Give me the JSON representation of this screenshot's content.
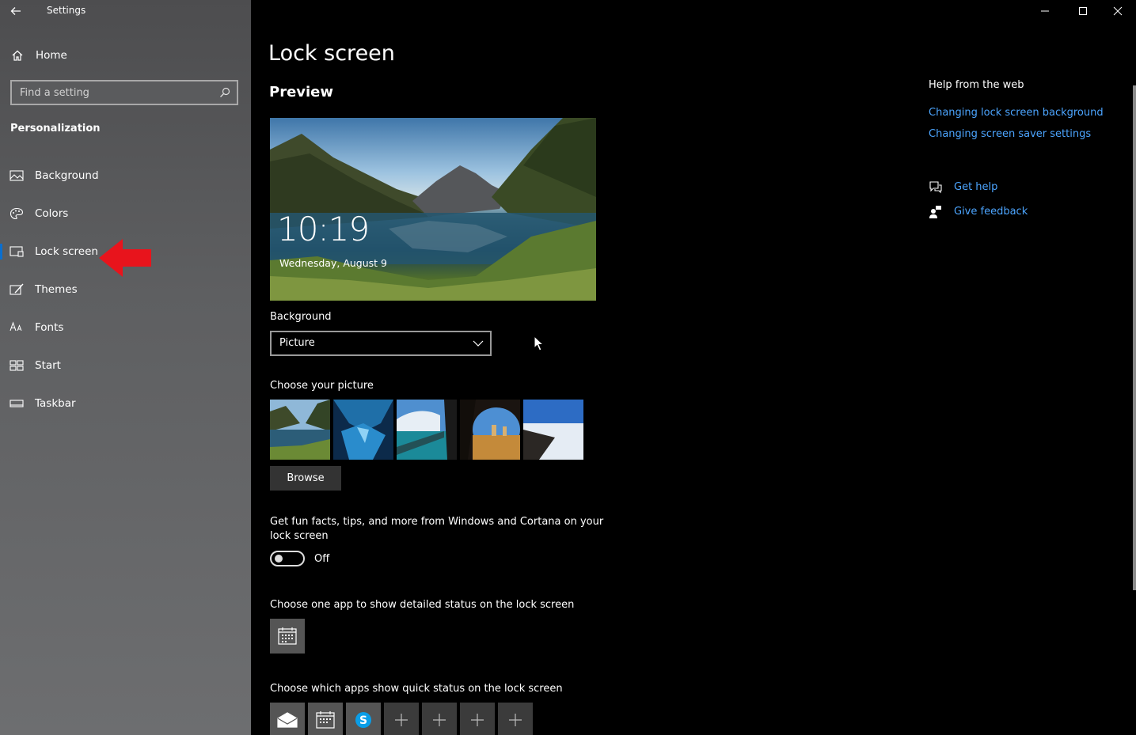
{
  "window": {
    "title": "Settings",
    "controls": [
      "minimize",
      "maximize",
      "close"
    ]
  },
  "sidebar": {
    "home_label": "Home",
    "search_placeholder": "Find a setting",
    "section_title": "Personalization",
    "items": [
      {
        "label": "Background",
        "icon": "picture-icon"
      },
      {
        "label": "Colors",
        "icon": "palette-icon"
      },
      {
        "label": "Lock screen",
        "icon": "lock-screen-icon",
        "active": true
      },
      {
        "label": "Themes",
        "icon": "brush-icon"
      },
      {
        "label": "Fonts",
        "icon": "font-icon"
      },
      {
        "label": "Start",
        "icon": "start-grid-icon"
      },
      {
        "label": "Taskbar",
        "icon": "taskbar-icon"
      }
    ]
  },
  "main": {
    "title": "Lock screen",
    "preview_heading": "Preview",
    "preview_time": "10:19",
    "preview_date": "Wednesday, August 9",
    "background_label": "Background",
    "background_value": "Picture",
    "choose_picture_label": "Choose your picture",
    "browse_label": "Browse",
    "facts_text": "Get fun facts, tips, and more from Windows and Cortana on your lock screen",
    "facts_toggle": "Off",
    "detail_status_label": "Choose one app to show detailed status on the lock screen",
    "quick_status_label": "Choose which apps show quick status on the lock screen",
    "quick_status_apps": [
      "mail-icon",
      "calendar-icon",
      "skype-icon",
      "plus-icon",
      "plus-icon",
      "plus-icon",
      "plus-icon"
    ]
  },
  "help": {
    "heading": "Help from the web",
    "links": [
      "Changing lock screen background",
      "Changing screen saver settings"
    ],
    "get_help": "Get help",
    "give_feedback": "Give feedback"
  },
  "colors": {
    "accent": "#0a6fd0",
    "link": "#4ca5ff",
    "annotation_arrow": "#e8141c"
  }
}
